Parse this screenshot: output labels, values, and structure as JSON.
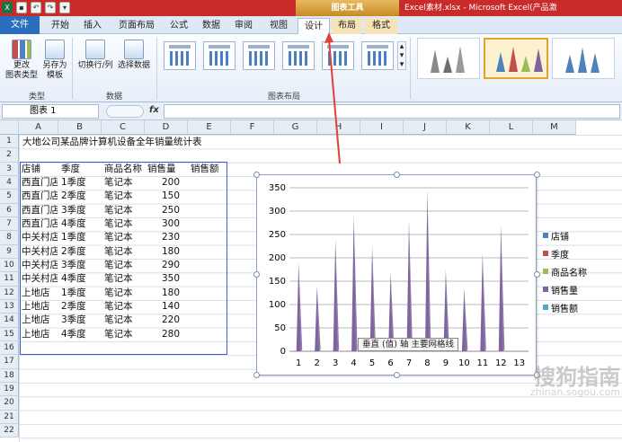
{
  "window": {
    "title": "Excel素材.xlsx - Microsoft Excel(产品激",
    "chart_tools_label": "图表工具"
  },
  "tabs": [
    {
      "label": "文件"
    },
    {
      "label": "开始"
    },
    {
      "label": "插入"
    },
    {
      "label": "页面布局"
    },
    {
      "label": "公式"
    },
    {
      "label": "数据"
    },
    {
      "label": "审阅"
    },
    {
      "label": "视图"
    },
    {
      "label": "设计"
    },
    {
      "label": "布局"
    },
    {
      "label": "格式"
    }
  ],
  "ribbon": {
    "change_type": "更改\n图表类型",
    "save_template": "另存为\n模板",
    "switch_row_col": "切换行/列",
    "select_data": "选择数据",
    "group_type": "类型",
    "group_data": "数据",
    "group_layout": "图表布局"
  },
  "formula_bar": {
    "name_box": "图表 1",
    "fx": "fx"
  },
  "columns": [
    "A",
    "B",
    "C",
    "D",
    "E",
    "F",
    "G",
    "H",
    "I",
    "J",
    "K",
    "L",
    "M"
  ],
  "rows": [
    "1",
    "2",
    "3",
    "4",
    "5",
    "6",
    "7",
    "8",
    "9",
    "10",
    "11",
    "12",
    "13",
    "14",
    "15",
    "16",
    "17",
    "18",
    "19",
    "20",
    "21",
    "22"
  ],
  "sheet": {
    "title": "大地公司某品牌计算机设备全年销量统计表",
    "headers": [
      "店铺",
      "季度",
      "商品名称",
      "销售量",
      "销售额"
    ],
    "data": [
      [
        "西直门店",
        "1季度",
        "笔记本",
        "200"
      ],
      [
        "西直门店",
        "2季度",
        "笔记本",
        "150"
      ],
      [
        "西直门店",
        "3季度",
        "笔记本",
        "250"
      ],
      [
        "西直门店",
        "4季度",
        "笔记本",
        "300"
      ],
      [
        "中关村店",
        "1季度",
        "笔记本",
        "230"
      ],
      [
        "中关村店",
        "2季度",
        "笔记本",
        "180"
      ],
      [
        "中关村店",
        "3季度",
        "笔记本",
        "290"
      ],
      [
        "中关村店",
        "4季度",
        "笔记本",
        "350"
      ],
      [
        "上地店",
        "1季度",
        "笔记本",
        "180"
      ],
      [
        "上地店",
        "2季度",
        "笔记本",
        "140"
      ],
      [
        "上地店",
        "3季度",
        "笔记本",
        "220"
      ],
      [
        "上地店",
        "4季度",
        "笔记本",
        "280"
      ]
    ]
  },
  "chart_data": {
    "type": "bar",
    "categories": [
      "1",
      "2",
      "3",
      "4",
      "5",
      "6",
      "7",
      "8",
      "9",
      "10",
      "11",
      "12",
      "13"
    ],
    "series": [
      {
        "name": "店铺",
        "color": "#4f81bd",
        "values": []
      },
      {
        "name": "季度",
        "color": "#c0504d",
        "values": []
      },
      {
        "name": "商品名称",
        "color": "#9bbb59",
        "values": []
      },
      {
        "name": "销售量",
        "color": "#8064a2",
        "values": [
          190,
          140,
          240,
          290,
          225,
          170,
          280,
          345,
          175,
          135,
          210,
          270
        ]
      },
      {
        "name": "销售额",
        "color": "#4bacc6",
        "values": []
      }
    ],
    "yticks": [
      "0",
      "50",
      "100",
      "150",
      "200",
      "250",
      "300",
      "350"
    ],
    "ylim": [
      0,
      350
    ],
    "tooltip": "垂直 (值) 轴 主要网格线",
    "grid": true,
    "legend": "right"
  },
  "watermark": {
    "text": "搜狗指南",
    "sub": "zhinan.sogou.com"
  }
}
